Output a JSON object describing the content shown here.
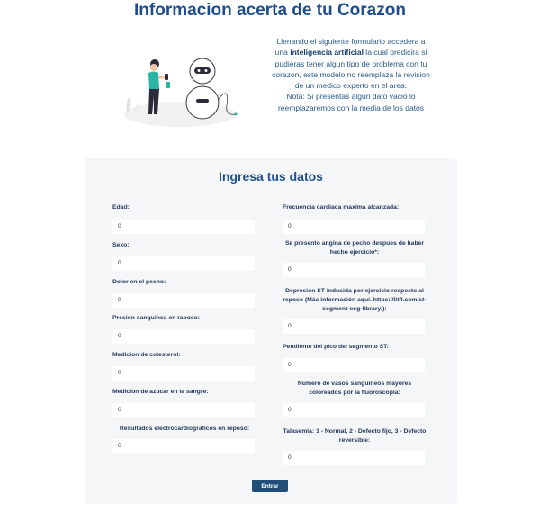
{
  "header": {
    "title": "Informacion acerta de tu Corazon"
  },
  "intro": {
    "prefix": "Llenando el siguiente formulario accedera a una ",
    "highlight": "inteligencia artificial",
    "suffix": " la cual predicira si pudieras tener algun tipo de problema con tu corazon, este modelo no reemplaza la revision de un medico experto en el area.",
    "note": "Nota: Si presentas algun dato vacio lo reemplazaremos con la media de los datos"
  },
  "form": {
    "title": "Ingresa tus datos",
    "left": [
      {
        "label": "Edad:",
        "value": "0"
      },
      {
        "label": "Sexo:",
        "value": "0"
      },
      {
        "label": "Dolor en el pecho:",
        "value": "0"
      },
      {
        "label": "Presion sanguinea en raposo:",
        "value": "0"
      },
      {
        "label": "Medicion de colesterol:",
        "value": "0"
      },
      {
        "label": "Medicion de azucar en la sangre:",
        "value": "0"
      },
      {
        "label": "Resultados electrocardiograficos en reposo:",
        "value": "0"
      }
    ],
    "right": [
      {
        "label": "Frecuencia cardiaca maxima alcanzada:",
        "value": "0"
      },
      {
        "label": "Se presento angina de pecho despues de haber hecho ejercicio*:",
        "value": "0"
      },
      {
        "label": "Depresión ST inducida por ejercicio respecto al reposo (Más información aquí. https://litfl.com/st-segment-ecg-library/):",
        "value": "0"
      },
      {
        "label": "Pendiente del pico del segmento ST:",
        "value": "0"
      },
      {
        "label": "Número de vasos sanguineos mayores coloreados por la fluoroscopia:",
        "value": "0"
      },
      {
        "label": "Talasemia: 1 - Normal, 2 - Defecto fijo, 3 - Defecto reversible:",
        "value": "0"
      }
    ],
    "submit_label": "Entrar"
  },
  "colors": {
    "title": "#1f4e8c",
    "button": "#1f4e79",
    "card": "#f5f6f7",
    "accent": "#2bb3a3"
  }
}
